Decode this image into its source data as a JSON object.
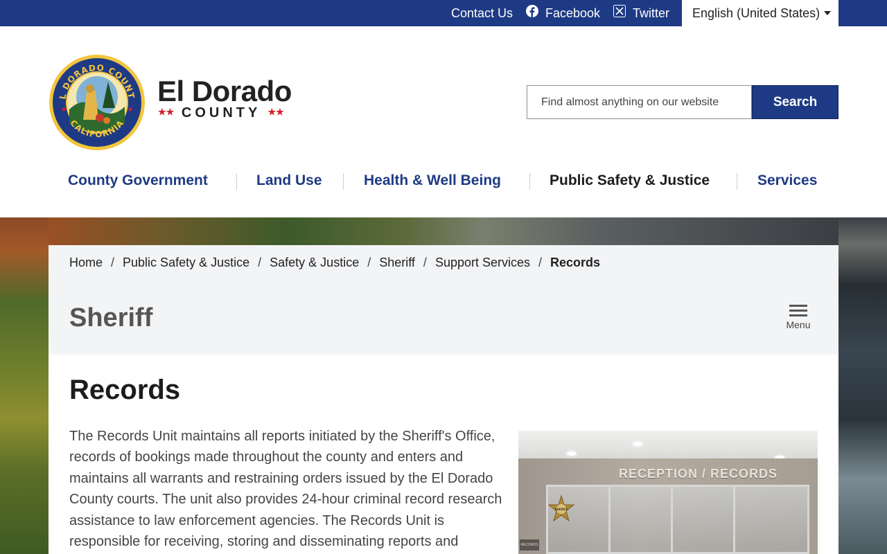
{
  "colors": {
    "brand_navy": "#1e3a84",
    "panel_gray": "#f3f4f6",
    "star_red": "#d0202a",
    "text_dark": "#1c1c1c"
  },
  "topbar": {
    "contact": "Contact Us",
    "facebook": "Facebook",
    "twitter": "Twitter",
    "language": "English (United States)"
  },
  "logo": {
    "seal_text_top": "EL DORADO COUNTY",
    "seal_text_bottom": "CALIFORNIA",
    "title": "El Dorado",
    "subtitle": "COUNTY",
    "stars": "★★"
  },
  "search": {
    "placeholder": "Find almost anything on our website",
    "button": "Search"
  },
  "nav": {
    "items": [
      {
        "label": "County Government"
      },
      {
        "label": "Land Use"
      },
      {
        "label": "Health & Well Being"
      },
      {
        "label": "Public Safety & Justice",
        "active": true
      },
      {
        "label": "Services"
      }
    ]
  },
  "breadcrumb": {
    "separator": "/",
    "items": [
      "Home",
      "Public Safety & Justice",
      "Safety & Justice",
      "Sheriff",
      "Support Services",
      "Records"
    ]
  },
  "section": {
    "title": "Sheriff",
    "menu_label": "Menu"
  },
  "page": {
    "title": "Records",
    "body": "The Records Unit maintains all reports initiated by the Sheriff's Office, records of bookings made throughout the county and enters and maintains all warrants and restraining orders issued by the El Dorado County courts. The unit also provides 24-hour criminal record research assistance to law enforcement agencies. The Records Unit is responsible for receiving, storing and disseminating reports and"
  },
  "photo": {
    "sign": "RECEPTION / RECORDS",
    "badge_text": "SHERIFF",
    "panel_label": "RECORDS"
  }
}
